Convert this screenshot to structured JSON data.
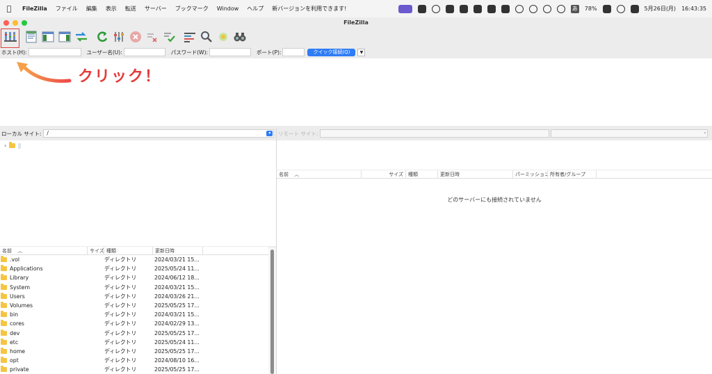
{
  "menubar": {
    "app_name": "FileZilla",
    "items": [
      "ファイル",
      "編集",
      "表示",
      "転送",
      "サーバー",
      "ブックマーク",
      "Window",
      "ヘルプ",
      "新バージョンを利用できます!"
    ],
    "battery": "78%",
    "ime": "あ",
    "date": "5月26日(月)",
    "time": "16:43:35"
  },
  "window": {
    "title": "FileZilla",
    "traffic_colors": [
      "#ff5f57",
      "#febc2e",
      "#28c840"
    ]
  },
  "toolbar": {
    "buttons": [
      "site-manager",
      "message-log",
      "local-tree",
      "remote-tree",
      "transfer-queue",
      "refresh",
      "filter",
      "cancel",
      "disconnect",
      "reconnect",
      "directory-compare",
      "search",
      "sync-browse",
      "find-files"
    ]
  },
  "quickconnect": {
    "host_label": "ホスト(H):",
    "user_label": "ユーザー名(U):",
    "password_label": "パスワード(W):",
    "port_label": "ポート(P):",
    "button_label": "クイック接続(Q)",
    "host_value": "",
    "user_value": "",
    "password_value": "",
    "port_value": ""
  },
  "annotation": {
    "text": "クリック！",
    "color": "#e23c3c"
  },
  "local": {
    "site_label": "ローカル サイト:",
    "path": "/",
    "tree_root": "",
    "columns": {
      "name": "名前",
      "size": "サイズ",
      "type": "種類",
      "date": "更新日時"
    },
    "files": [
      {
        "name": ".vol",
        "type": "ディレクトリ",
        "date": "2024/03/21 15..."
      },
      {
        "name": "Applications",
        "type": "ディレクトリ",
        "date": "2025/05/24 11..."
      },
      {
        "name": "Library",
        "type": "ディレクトリ",
        "date": "2024/06/12 18..."
      },
      {
        "name": "System",
        "type": "ディレクトリ",
        "date": "2024/03/21 15..."
      },
      {
        "name": "Users",
        "type": "ディレクトリ",
        "date": "2024/03/26 21..."
      },
      {
        "name": "Volumes",
        "type": "ディレクトリ",
        "date": "2025/05/25 17..."
      },
      {
        "name": "bin",
        "type": "ディレクトリ",
        "date": "2024/03/21 15..."
      },
      {
        "name": "cores",
        "type": "ディレクトリ",
        "date": "2024/02/29 13..."
      },
      {
        "name": "dev",
        "type": "ディレクトリ",
        "date": "2025/05/25 17..."
      },
      {
        "name": "etc",
        "type": "ディレクトリ",
        "date": "2025/05/24 11..."
      },
      {
        "name": "home",
        "type": "ディレクトリ",
        "date": "2025/05/25 17..."
      },
      {
        "name": "opt",
        "type": "ディレクトリ",
        "date": "2024/08/10 16..."
      },
      {
        "name": "private",
        "type": "ディレクトリ",
        "date": "2025/05/25 17..."
      }
    ]
  },
  "remote": {
    "site_label": "リモート サイト:",
    "columns": {
      "name": "名前",
      "size": "サイズ",
      "type": "種類",
      "date": "更新日時",
      "permissions": "パーミッション",
      "owner": "所有者/グループ"
    },
    "empty_message": "どのサーバーにも接続されていません"
  }
}
